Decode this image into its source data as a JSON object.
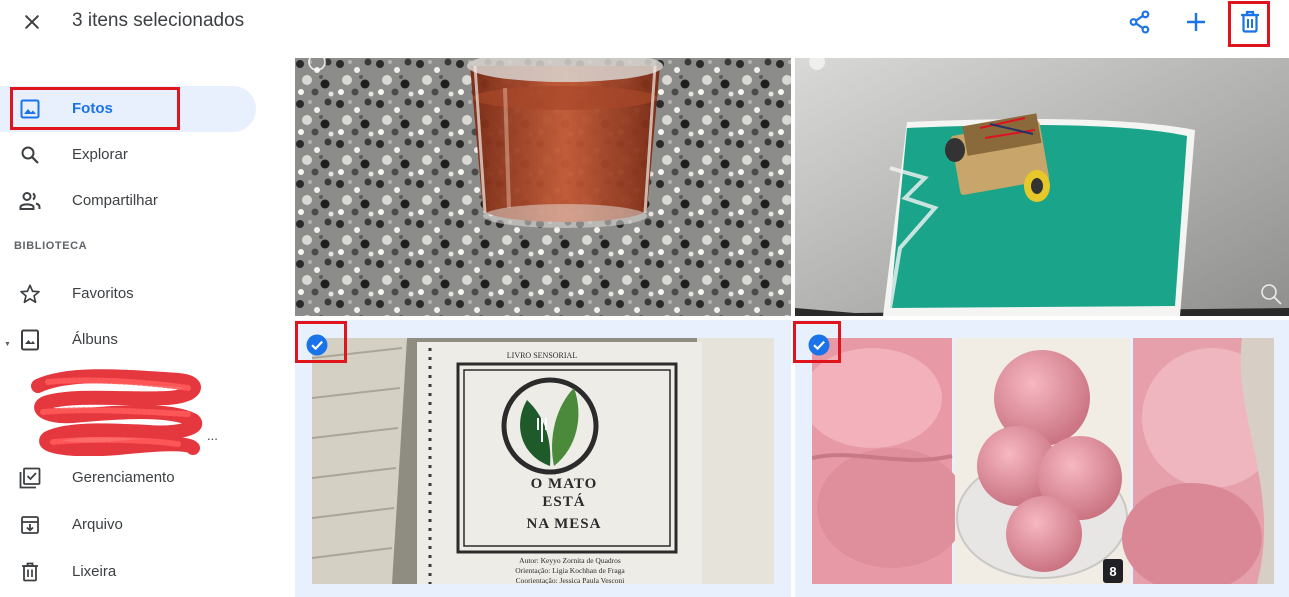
{
  "header": {
    "selection_text": "3 itens selecionados",
    "close_icon": "close-icon",
    "actions": [
      {
        "name": "share",
        "icon": "share-icon"
      },
      {
        "name": "add",
        "icon": "plus-icon"
      },
      {
        "name": "delete",
        "icon": "trash-icon"
      }
    ]
  },
  "sidebar": {
    "items": [
      {
        "label": "Fotos",
        "icon": "photo-icon",
        "active": true
      },
      {
        "label": "Explorar",
        "icon": "search-icon"
      },
      {
        "label": "Compartilhar",
        "icon": "people-icon"
      }
    ],
    "section_label": "BIBLIOTECA",
    "library_items": [
      {
        "label": "Favoritos",
        "icon": "star-icon"
      },
      {
        "label": "Álbuns",
        "icon": "album-icon"
      }
    ],
    "redacted_more": "...",
    "bottom_items": [
      {
        "label": "Gerenciamento",
        "icon": "checklist-icon"
      },
      {
        "label": "Arquivo",
        "icon": "archive-icon"
      },
      {
        "label": "Lixeira",
        "icon": "trash-icon"
      }
    ]
  },
  "grid": {
    "photos": [
      {
        "subject": "cup",
        "selected": false
      },
      {
        "subject": "robot",
        "selected": false
      },
      {
        "subject": "book",
        "selected": true
      },
      {
        "subject": "pink-dough",
        "selected": true
      }
    ],
    "book": {
      "header": "LIVRO SENSORIAL",
      "title_line1": "O MATO",
      "title_line2": "ESTÁ",
      "title_line3": "NA MESA",
      "credit1": "Autor: Keyyo Zornita de Quadros",
      "credit2": "Orientação: Ligia Kochhan de Fraga",
      "credit3": "Coorientação: Jessica Paula Vesconi"
    },
    "stack_badge": "8"
  },
  "colors": {
    "accent": "#1a73e8",
    "active_bg": "#e8f0fe",
    "highlight_red": "#e0141c"
  }
}
